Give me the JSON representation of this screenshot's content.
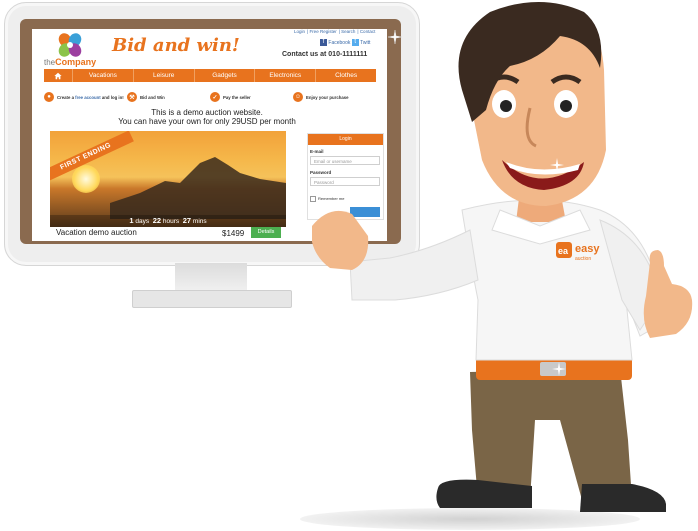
{
  "site": {
    "logo_prefix": "the",
    "logo_name": "Company",
    "tagline": "Bid and win!",
    "top_links": [
      "Login",
      "Free Register",
      "Search",
      "Contact"
    ],
    "social": {
      "facebook": "Facebook",
      "twitter": "Twitt"
    },
    "contact": "Contact us at 010-1111111"
  },
  "nav": {
    "home_icon": "home-icon",
    "items": [
      "Vacations",
      "Leisure",
      "Gadgets",
      "Electronics",
      "Clothes"
    ]
  },
  "steps": [
    {
      "num": "1",
      "text_a": "Create a ",
      "link": "free account",
      "text_b": " and log in!"
    },
    {
      "num": "2",
      "text_a": "Bid and Win",
      "link": "",
      "text_b": ""
    },
    {
      "num": "3",
      "text_a": "Pay the seller",
      "link": "",
      "text_b": ""
    },
    {
      "num": "4",
      "text_a": "Enjoy your purchase",
      "link": "",
      "text_b": ""
    }
  ],
  "demo_message": {
    "line1": "This is a demo auction website.",
    "line2": "You can have your own for only 29USD per month"
  },
  "featured": {
    "ribbon": "FIRST ENDING",
    "days_num": "1",
    "days_label": "days",
    "hours_num": "22",
    "hours_label": "hours",
    "mins_num": "27",
    "mins_label": "mins",
    "title": "Vacation demo auction",
    "price": "$1499",
    "details_label": "Details"
  },
  "login": {
    "header": "Login",
    "email_label": "E-mail",
    "email_placeholder": "Email or username",
    "password_label": "Password",
    "password_placeholder": "Password",
    "remember_label": "Remember me"
  },
  "mascot": {
    "shirt_logo_mark": "ea",
    "shirt_logo_line1": "easy",
    "shirt_logo_line2": "auction"
  },
  "colors": {
    "brand_orange": "#e8731e",
    "link_blue": "#3a6aa8",
    "details_green": "#4caf50",
    "bezel_brown": "#8a6a4f"
  }
}
